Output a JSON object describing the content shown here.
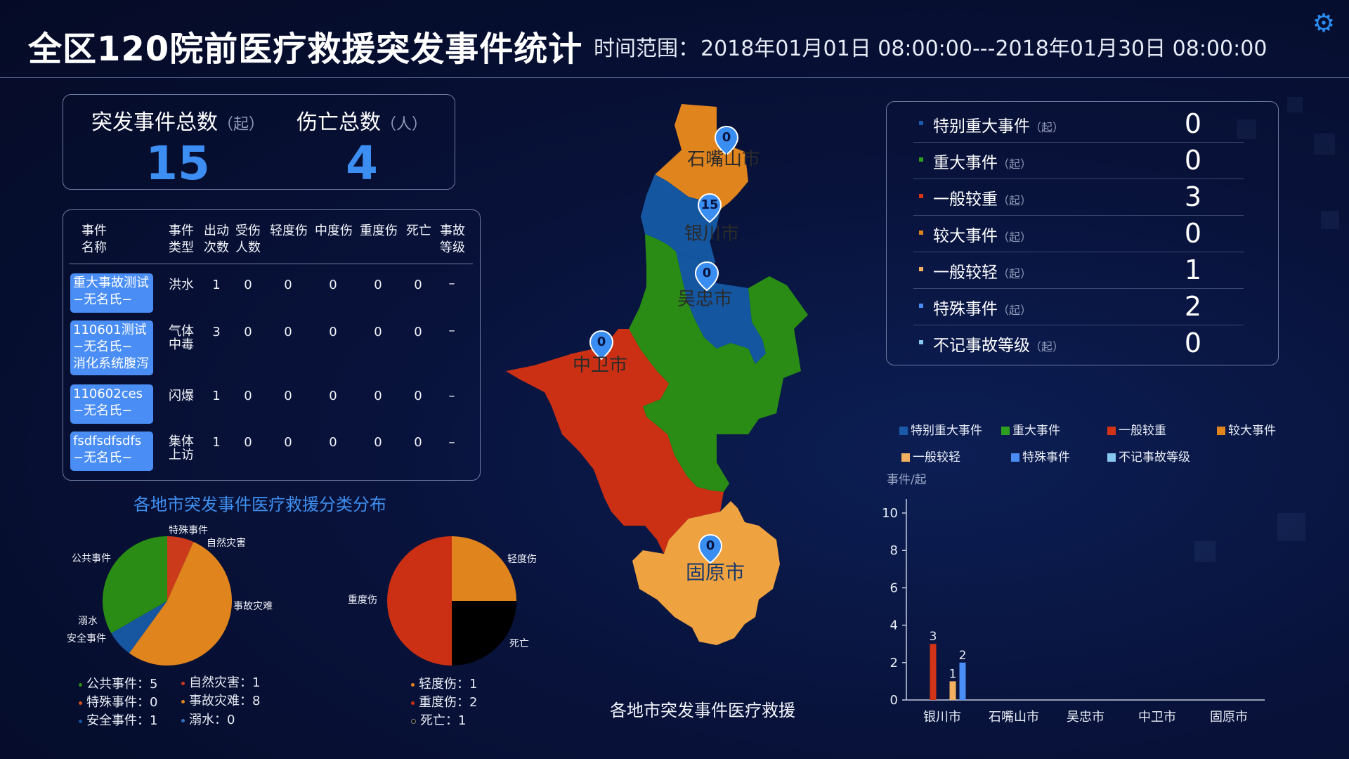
{
  "header": {
    "title": "全区120院前医疗救援突发事件统计",
    "range_label": "时间范围：",
    "range_value": "2018年01月01日 08:00:00---2018年01月30日 08:00:00",
    "settings_icon": "gear-icon",
    "accent": "#2a8cf0"
  },
  "totals": {
    "events_label": "突发事件总数",
    "events_unit": "（起）",
    "events_value": "15",
    "casualty_label": "伤亡总数",
    "casualty_unit": "（人）",
    "casualty_value": "4",
    "value_color": "#3d8ef3"
  },
  "event_table": {
    "headers": [
      "事件\n名称",
      "事件\n类型",
      "出动\n次数",
      "受伤\n人数",
      "轻度伤",
      "中度伤",
      "重度伤",
      "死亡",
      "事故\n等级"
    ],
    "rows": [
      {
        "name": "重大事故测试\n−无名氏−",
        "type": "洪水",
        "dispatch": "1",
        "injured": "0",
        "light": "0",
        "medium": "0",
        "severe": "0",
        "death": "0",
        "level": "–"
      },
      {
        "name": "110601测试\n−无名氏−\n消化系统腹泻",
        "type": "气体\n中毒",
        "dispatch": "3",
        "injured": "0",
        "light": "0",
        "medium": "0",
        "severe": "0",
        "death": "0",
        "level": "–"
      },
      {
        "name": "110602ces\n−无名氏−",
        "type": "闪爆",
        "dispatch": "1",
        "injured": "0",
        "light": "0",
        "medium": "0",
        "severe": "0",
        "death": "0",
        "level": "–"
      },
      {
        "name": "fsdfsdfsdfs\n−无名氏−",
        "type": "集体\n上访",
        "dispatch": "1",
        "injured": "0",
        "light": "0",
        "medium": "0",
        "severe": "0",
        "death": "0",
        "level": "–"
      }
    ]
  },
  "pies": {
    "title": "各地市突发事件医疗救援分类分布",
    "category_labels": {
      "special": "特殊事件",
      "natural": "自然灾害",
      "public": "公共事件",
      "accident": "事故灾难",
      "drowning": "溺水",
      "safety": "安全事件"
    },
    "category_legend": [
      "公共事件：5",
      "自然灾害：1",
      "特殊事件：0",
      "事故灾难：8",
      "安全事件：1",
      "溺水：0"
    ],
    "injury_labels": {
      "light": "轻度伤",
      "severe": "重度伤",
      "death": "死亡"
    },
    "injury_legend": [
      "轻度伤：1",
      "重度伤：2",
      "死亡：1"
    ]
  },
  "map": {
    "title": "各地市突发事件医疗救援",
    "cities": [
      {
        "name": "石嘴山市",
        "count": "0",
        "color": "#e0841e"
      },
      {
        "name": "银川市",
        "count": "15",
        "color": "#1556a0"
      },
      {
        "name": "吴忠市",
        "count": "0",
        "color": "#2a8c14"
      },
      {
        "name": "中卫市",
        "count": "0",
        "color": "#cc3014"
      },
      {
        "name": "固原市",
        "count": "0",
        "color": "#eea240"
      }
    ]
  },
  "stats": {
    "unit": "（起）",
    "rows": [
      {
        "label": "特别重大事件",
        "value": "0",
        "color": "#1a5aa8"
      },
      {
        "label": "重大事件",
        "value": "0",
        "color": "#2e9e1e"
      },
      {
        "label": "一般较重",
        "value": "3",
        "color": "#d23418"
      },
      {
        "label": "较大事件",
        "value": "0",
        "color": "#e0841e"
      },
      {
        "label": "一般较轻",
        "value": "1",
        "color": "#f2b060"
      },
      {
        "label": "特殊事件",
        "value": "2",
        "color": "#4a8ef5"
      },
      {
        "label": "不记事故等级",
        "value": "0",
        "color": "#86c8f0"
      }
    ]
  },
  "chart_data": [
    {
      "type": "pie",
      "title": "各地市突发事件医疗救援分类分布",
      "labels": [
        "公共事件",
        "自然灾害",
        "特殊事件",
        "事故灾难",
        "安全事件",
        "溺水"
      ],
      "values": [
        5,
        1,
        0,
        8,
        1,
        0
      ],
      "colors": [
        "#2a8c14",
        "#cc3a1c",
        "#d2501a",
        "#e0841e",
        "#1756a0",
        "#2e6fc0"
      ]
    },
    {
      "type": "pie",
      "labels": [
        "轻度伤",
        "重度伤",
        "死亡"
      ],
      "values": [
        1,
        2,
        1
      ],
      "colors": [
        "#e0841e",
        "#cc3014",
        "#000000"
      ]
    },
    {
      "type": "bar",
      "ylabel": "事件/起",
      "ylim": [
        0,
        10
      ],
      "yticks": [
        0,
        2,
        4,
        6,
        8,
        10
      ],
      "categories": [
        "银川市",
        "石嘴山市",
        "吴忠市",
        "中卫市",
        "固原市"
      ],
      "legend_position": "top",
      "series": [
        {
          "name": "特别重大事件",
          "color": "#1a5aa8",
          "values": [
            0,
            0,
            0,
            0,
            0
          ]
        },
        {
          "name": "重大事件",
          "color": "#2e9e1e",
          "values": [
            0,
            0,
            0,
            0,
            0
          ]
        },
        {
          "name": "一般较重",
          "color": "#d23418",
          "values": [
            3,
            0,
            0,
            0,
            0
          ]
        },
        {
          "name": "较大事件",
          "color": "#e0841e",
          "values": [
            0,
            0,
            0,
            0,
            0
          ]
        },
        {
          "name": "一般较轻",
          "color": "#f2b060",
          "values": [
            1,
            0,
            0,
            0,
            0
          ]
        },
        {
          "name": "特殊事件",
          "color": "#4a8ef5",
          "values": [
            2,
            0,
            0,
            0,
            0
          ]
        },
        {
          "name": "不记事故等级",
          "color": "#86c8f0",
          "values": [
            0,
            0,
            0,
            0,
            0
          ]
        }
      ]
    }
  ]
}
